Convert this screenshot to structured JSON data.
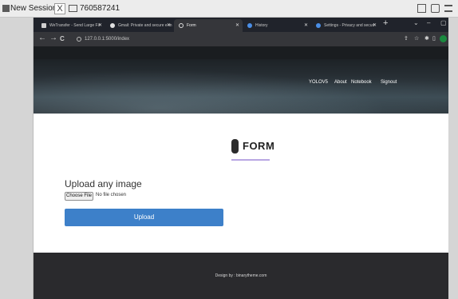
{
  "session": {
    "title": "New Session",
    "close_glyph": "X",
    "session_id": "760587241"
  },
  "browser": {
    "tabs": [
      {
        "label": "WeTransfer - Send Large Fil",
        "icon": "wetransfer-icon",
        "active": false
      },
      {
        "label": "Gmail: Private and secure e-m",
        "icon": "google-icon",
        "active": false
      },
      {
        "label": "Form",
        "icon": "loading-icon",
        "active": true
      },
      {
        "label": "History",
        "icon": "history-icon",
        "active": false
      },
      {
        "label": "Settings - Privacy and securi",
        "icon": "settings-icon",
        "active": false
      }
    ],
    "new_tab_glyph": "+",
    "nav": {
      "back": "←",
      "forward": "→",
      "reload": "C"
    },
    "url": "127.0.0.1:5000/index"
  },
  "site": {
    "nav_items": [
      "YOLOV5",
      "About",
      "Notebook",
      "Signout"
    ],
    "form_heading": "FORM",
    "upload_label": "Upload any image",
    "choose_file_label": "Choose File",
    "no_file_text": "No file chosen",
    "upload_button": "Upload",
    "footer_text": "Design by : binarytheme.com"
  },
  "colors": {
    "upload_button": "#3d80c9",
    "heading_underline": "#b9a7e3",
    "footer": "#2a2a2d",
    "browser_chrome": "#35363a"
  }
}
